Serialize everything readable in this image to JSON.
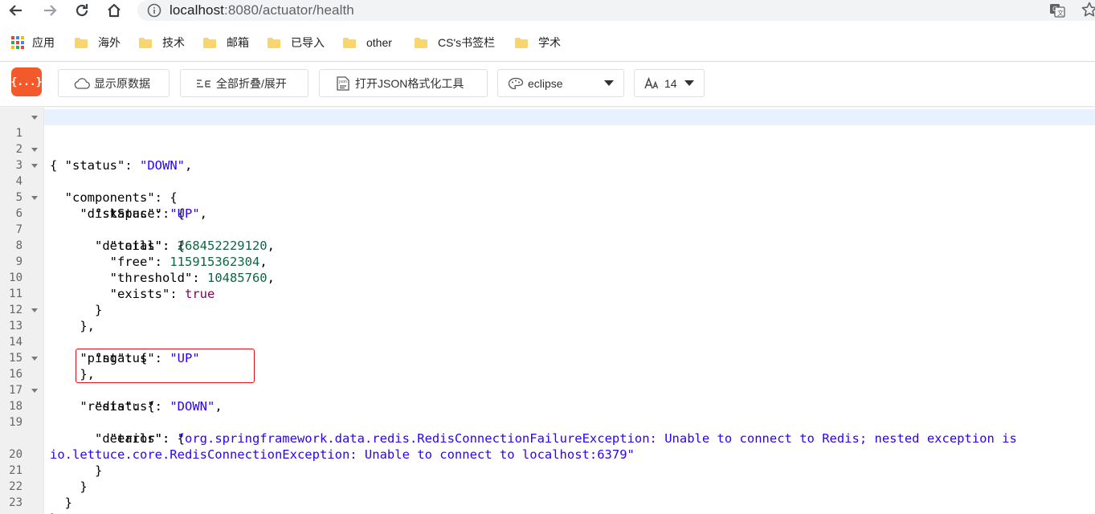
{
  "browser": {
    "url_host": "localhost",
    "url_path": ":8080/actuator/health"
  },
  "bookmarks": [
    {
      "label": "应用",
      "icon": "apps-grid-icon"
    },
    {
      "label": "海外",
      "icon": "folder-icon"
    },
    {
      "label": "技术",
      "icon": "folder-icon"
    },
    {
      "label": "邮箱",
      "icon": "folder-icon"
    },
    {
      "label": "已导入",
      "icon": "folder-icon"
    },
    {
      "label": "other",
      "icon": "folder-icon"
    },
    {
      "label": "CS's书签栏",
      "icon": "folder-icon"
    },
    {
      "label": "学术",
      "icon": "folder-icon"
    }
  ],
  "toolbar": {
    "logo_text": "{...}",
    "raw_label": "显示原数据",
    "fold_label": "全部折叠/展开",
    "formatter_label": "打开JSON格式化工具",
    "theme_value": "eclipse",
    "fontsize_value": "14"
  },
  "colors": {
    "logo": "#f35a2b",
    "string": "#2a00ff",
    "number": "#116644",
    "keyword": "#7f0055",
    "highlight_box": "#e0101a"
  },
  "code_lines": [
    {
      "n": "1",
      "fold": true
    },
    {
      "n": "2",
      "fold": false
    },
    {
      "n": "3",
      "fold": true
    },
    {
      "n": "4",
      "fold": true
    },
    {
      "n": "5",
      "fold": false
    },
    {
      "n": "6",
      "fold": true
    },
    {
      "n": "7",
      "fold": false
    },
    {
      "n": "8",
      "fold": false
    },
    {
      "n": "9",
      "fold": false
    },
    {
      "n": "10",
      "fold": false
    },
    {
      "n": "11",
      "fold": false
    },
    {
      "n": "12",
      "fold": false
    },
    {
      "n": "13",
      "fold": true
    },
    {
      "n": "14",
      "fold": false
    },
    {
      "n": "15",
      "fold": false
    },
    {
      "n": "16",
      "fold": true
    },
    {
      "n": "17",
      "fold": false
    },
    {
      "n": "18",
      "fold": true
    },
    {
      "n": "19",
      "fold": false
    },
    {
      "n": "",
      "fold": false
    },
    {
      "n": "20",
      "fold": false
    },
    {
      "n": "21",
      "fold": false
    },
    {
      "n": "22",
      "fold": false
    },
    {
      "n": "23",
      "fold": false
    }
  ],
  "json": {
    "status_key": "\"status\"",
    "status_val": "\"DOWN\"",
    "components_key": "\"components\"",
    "diskspace_key": "\"diskSpace\"",
    "disk_status_key": "\"status\"",
    "disk_status_val": "\"UP\"",
    "disk_details_key": "\"details\"",
    "total_key": "\"total\"",
    "total_val": "268452229120",
    "free_key": "\"free\"",
    "free_val": "115915362304",
    "threshold_key": "\"threshold\"",
    "threshold_val": "10485760",
    "exists_key": "\"exists\"",
    "exists_val": "true",
    "ping_key": "\"ping\"",
    "ping_status_key": "\"status\"",
    "ping_status_val": "\"UP\"",
    "redis_key": "\"redis\"",
    "redis_status_key": "\"status\"",
    "redis_status_val": "\"DOWN\"",
    "redis_details_key": "\"details\"",
    "error_key": "\"error\"",
    "error_val_1": "\"org.springframework.data.redis.RedisConnectionFailureException: Unable to connect to Redis; nested exception is",
    "error_val_2": "io.lettuce.core.RedisConnectionException: Unable to connect to localhost:6379\""
  }
}
